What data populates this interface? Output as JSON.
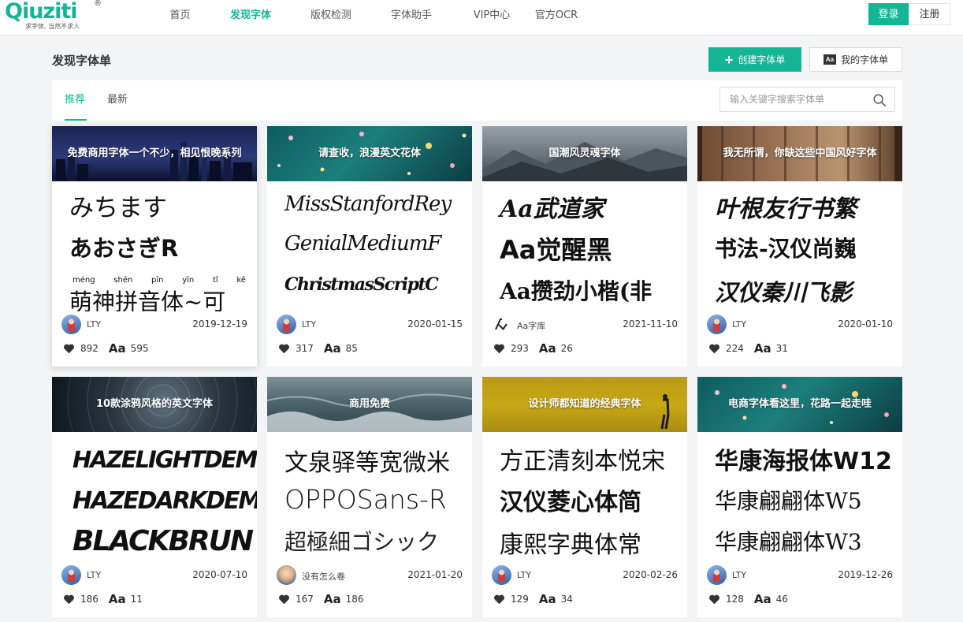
{
  "header": {
    "logo_text": "Qiuziti",
    "logo_tagline": "求字体, 当然不求人",
    "nav": [
      {
        "label": "首页"
      },
      {
        "label": "发现字体"
      },
      {
        "label": "版权检测"
      },
      {
        "label": "字体助手"
      },
      {
        "label": "VIP中心"
      },
      {
        "label": "官方OCR"
      }
    ],
    "active_nav_index": 1,
    "login_label": "登录",
    "register_label": "注册"
  },
  "page": {
    "title": "发现字体单",
    "create_button": "创建字体单",
    "mine_button": "我的字体单",
    "aa_badge": "Aa"
  },
  "tabs": {
    "items": [
      {
        "label": "推荐"
      },
      {
        "label": "最新"
      }
    ],
    "active_index": 0
  },
  "search": {
    "placeholder": "输入关键字搜索字体单"
  },
  "colors": {
    "accent": "#14b595",
    "heart": "#333333"
  },
  "cards": [
    {
      "title": "免费商用字体一个不少，相见恨晚系列",
      "samples": [
        "みちます",
        "あおさぎR",
        "萌神拼音体~可"
      ],
      "pinyin": [
        "méng",
        "shén",
        "pīn",
        "yīn",
        "tǐ",
        "kě"
      ],
      "author": "LTY",
      "date": "2019-12-19",
      "likes": "892",
      "fonts": "595"
    },
    {
      "title": "请查收，浪漫英文花体",
      "samples": [
        "MissStanfordRey",
        "GenialMediumF",
        "ChristmasScriptC"
      ],
      "author": "LTY",
      "date": "2020-01-15",
      "likes": "317",
      "fonts": "85"
    },
    {
      "title": "国潮风灵魂字体",
      "samples": [
        "Aa武道家",
        "Aa觉醒黑",
        "Aa攒劲小楷(非"
      ],
      "author": "Aa字库",
      "date": "2021-11-10",
      "likes": "293",
      "fonts": "26"
    },
    {
      "title": "我无所谓，你缺这些中国风好字体",
      "samples": [
        "叶根友行书繁",
        "书法-汉仪尚巍",
        "汉仪秦川飞影"
      ],
      "author": "LTY",
      "date": "2020-01-10",
      "likes": "224",
      "fonts": "31"
    },
    {
      "title": "10款涂鸦风格的英文字体",
      "samples": [
        "HAZELIGHTDEMO",
        "HAZEDARKDEMO",
        "BLACKBRUN"
      ],
      "author": "LTY",
      "date": "2020-07-10",
      "likes": "186",
      "fonts": "11"
    },
    {
      "title": "商用免费",
      "samples": [
        "文泉驿等宽微米",
        "OPPOSans-R",
        "超極細ゴシック"
      ],
      "author": "没有怎么卷",
      "date": "2021-01-20",
      "likes": "167",
      "fonts": "186"
    },
    {
      "title": "设计师都知道的经典字体",
      "samples": [
        "方正清刻本悦宋",
        "汉仪菱心体简",
        "康熙字典体常"
      ],
      "author": "LTY",
      "date": "2020-02-26",
      "likes": "129",
      "fonts": "34"
    },
    {
      "title": "电商字体看这里，花路一起走哇",
      "samples": [
        "华康海报体W12",
        "华康翩翩体W5",
        "华康翩翩体W3"
      ],
      "author": "LTY",
      "date": "2019-12-26",
      "likes": "128",
      "fonts": "46"
    }
  ]
}
